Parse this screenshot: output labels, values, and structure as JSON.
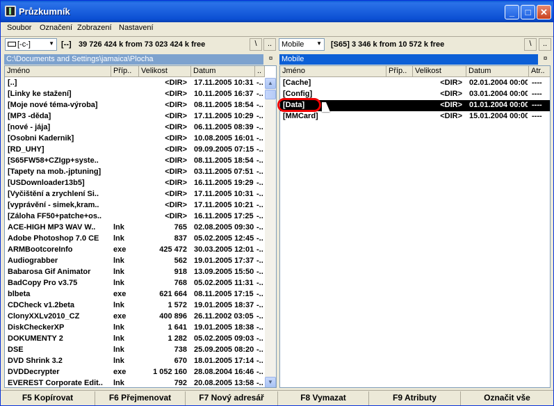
{
  "window": {
    "title": "Průzkumník",
    "minimize": "_",
    "maximize": "□",
    "close": "✕"
  },
  "menu": [
    "Soubor",
    "Označení",
    "Zobrazení",
    "Nastavení"
  ],
  "left": {
    "drive": "[-c-]",
    "drive_bracket": "[--]",
    "info": "39 726 424 k from 73 023 424 k free",
    "root_btn": "\\",
    "up_btn": "..",
    "path": "C:\\Documents and Settings\\jamaica\\Plocha",
    "pin": "¤",
    "headers": [
      "Jméno",
      "Příp..",
      "Velikost",
      "Datum",
      ".."
    ],
    "files": [
      [
        "[..]",
        "",
        "<DIR>",
        "17.11.2005 10:31",
        "-.."
      ],
      [
        "[Linky ke stažení]",
        "",
        "<DIR>",
        "10.11.2005 16:37",
        "-.."
      ],
      [
        "[Moje nové téma-výroba]",
        "",
        "<DIR>",
        "08.11.2005 18:54",
        "-.."
      ],
      [
        "[MP3 -děda]",
        "",
        "<DIR>",
        "17.11.2005 10:29",
        "-.."
      ],
      [
        "[nové - jája]",
        "",
        "<DIR>",
        "06.11.2005 08:39",
        "-.."
      ],
      [
        "[Osobni Kadernik]",
        "",
        "<DIR>",
        "10.08.2005 16:01",
        "-.."
      ],
      [
        "[RD_UHY]",
        "",
        "<DIR>",
        "09.09.2005 07:15",
        "-.."
      ],
      [
        "[S65FW58+CZIgp+syste..",
        "",
        "<DIR>",
        "08.11.2005 18:54",
        "-.."
      ],
      [
        "[Tapety na mob.-jptuning]",
        "",
        "<DIR>",
        "03.11.2005 07:51",
        "-.."
      ],
      [
        "[USDownloader13b5]",
        "",
        "<DIR>",
        "16.11.2005 19:29",
        "-.."
      ],
      [
        "[Vyčištění a zrychlení Si..",
        "",
        "<DIR>",
        "17.11.2005 10:31",
        "-.."
      ],
      [
        "[vyprávění - simek,kram..",
        "",
        "<DIR>",
        "17.11.2005 10:21",
        "-.."
      ],
      [
        "[Záloha FF50+patche+os..",
        "",
        "<DIR>",
        "16.11.2005 17:25",
        "-.."
      ],
      [
        "ACE-HIGH MP3 WAV W..",
        "lnk",
        "765",
        "02.08.2005 09:30",
        "-.."
      ],
      [
        "Adobe Photoshop 7.0 CE",
        "lnk",
        "837",
        "05.02.2005 12:45",
        "-.."
      ],
      [
        "ARMBootcoreInfo",
        "exe",
        "425 472",
        "30.03.2005 12:01",
        "-.."
      ],
      [
        "Audiograbber",
        "lnk",
        "562",
        "19.01.2005 17:37",
        "-.."
      ],
      [
        "Babarosa Gif Animator",
        "lnk",
        "918",
        "13.09.2005 15:50",
        "-.."
      ],
      [
        "BadCopy Pro v3.75",
        "lnk",
        "768",
        "05.02.2005 11:31",
        "-.."
      ],
      [
        "blbeta",
        "exe",
        "621 664",
        "08.11.2005 17:15",
        "-.."
      ],
      [
        "CDCheck v1.2beta",
        "lnk",
        "1 572",
        "19.01.2005 18:37",
        "-.."
      ],
      [
        "ClonyXXLv2010_CZ",
        "exe",
        "400 896",
        "26.11.2002 03:05",
        "-.."
      ],
      [
        "DiskCheckerXP",
        "lnk",
        "1 641",
        "19.01.2005 18:38",
        "-.."
      ],
      [
        "DOKUMENTY 2",
        "lnk",
        "1 282",
        "05.02.2005 09:03",
        "-.."
      ],
      [
        "DSE",
        "lnk",
        "738",
        "25.09.2005 08:20",
        "-.."
      ],
      [
        "DVD Shrink 3.2",
        "lnk",
        "670",
        "18.01.2005 17:14",
        "-.."
      ],
      [
        "DVDDecrypter",
        "exe",
        "1 052 160",
        "28.08.2004 16:46",
        "-.."
      ],
      [
        "EVEREST Corporate Edit..",
        "lnk",
        "792",
        "20.08.2005 13:58",
        "-.."
      ]
    ]
  },
  "right": {
    "drive": "Mobile",
    "info": "[S65]  3 346 k from 10 572 k free",
    "root_btn": "\\",
    "up_btn": "..",
    "path": "Mobile",
    "pin": "¤",
    "headers": [
      "Jméno",
      "Příp..",
      "Velikost",
      "Datum",
      "Atr.."
    ],
    "files": [
      [
        "[Cache]",
        "",
        "<DIR>",
        "02.01.2004 00:00",
        "----"
      ],
      [
        "[Config]",
        "",
        "<DIR>",
        "03.01.2004 00:00",
        "----"
      ],
      [
        "[Data]",
        "",
        "<DIR>",
        "01.01.2004 00:00",
        "----"
      ],
      [
        "[MMCard]",
        "",
        "<DIR>",
        "15.01.2004 00:00",
        "----"
      ]
    ],
    "selected_index": 2
  },
  "fkeys": [
    "F5 Kopírovat",
    "F6 Přejmenovat",
    "F7 Nový adresář",
    "F8 Vymazat",
    "F9 Atributy",
    "Označit vše"
  ]
}
